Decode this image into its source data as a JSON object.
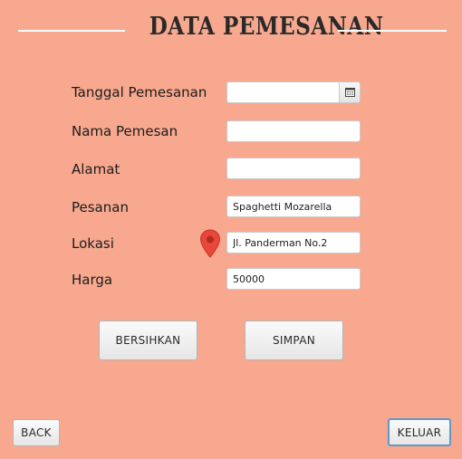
{
  "header": {
    "title": "DATA PEMESANAN"
  },
  "form": {
    "tanggal": {
      "label": "Tanggal Pemesanan",
      "value": ""
    },
    "nama": {
      "label": "Nama Pemesan",
      "value": ""
    },
    "alamat": {
      "label": "Alamat",
      "value": ""
    },
    "pesanan": {
      "label": "Pesanan",
      "value": "Spaghetti Mozarella"
    },
    "lokasi": {
      "label": "Lokasi",
      "value": "Jl. Panderman No.2",
      "icon": "map-pin-icon"
    },
    "harga": {
      "label": "Harga",
      "value": "50000"
    }
  },
  "actions": {
    "clear": "BERSIHKAN",
    "save": "SIMPAN"
  },
  "footer": {
    "back": "BACK",
    "exit": "KELUAR"
  },
  "colors": {
    "background": "#f8a88e",
    "pin": "#e8473b",
    "focus_border": "#5f99c4"
  }
}
